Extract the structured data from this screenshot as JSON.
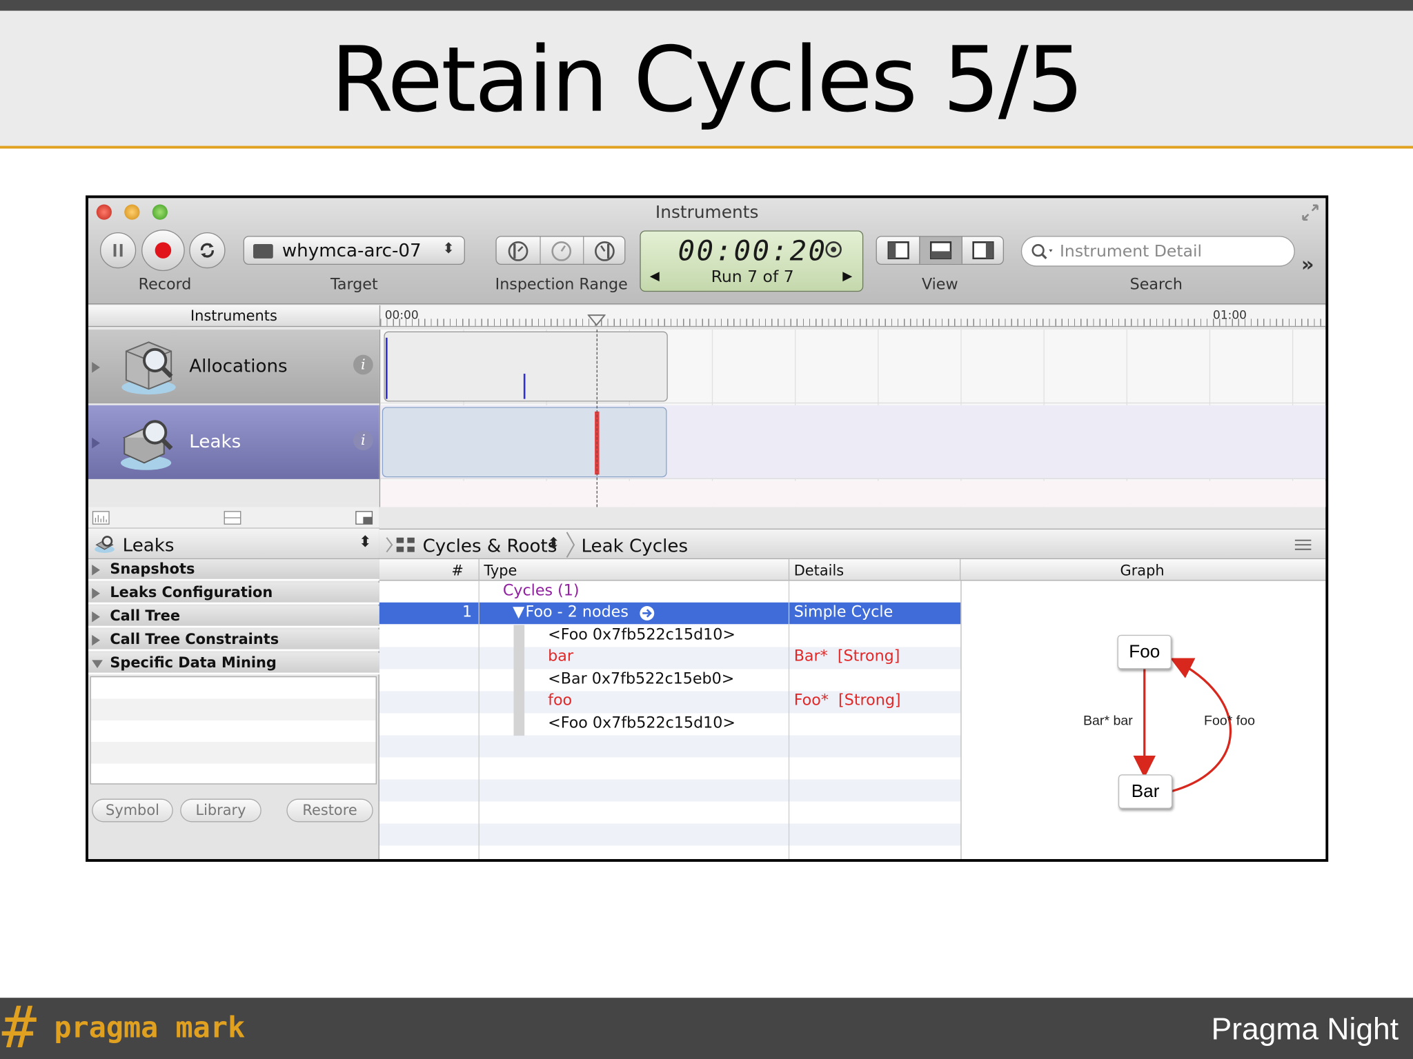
{
  "slide": {
    "title": "Retain Cycles 5/5",
    "footer_brand_symbol": "#",
    "footer_brand_text": "pragma mark",
    "footer_right": "Pragma Night",
    "accent_color": "#e0a020"
  },
  "window": {
    "title": "Instruments",
    "toolbar": {
      "record_label": "Record",
      "target_value": "whymca-arc-07",
      "target_label": "Target",
      "inspection_label": "Inspection Range",
      "timer": "00:00:20",
      "run_text": "Run 7 of 7",
      "view_label": "View",
      "search_placeholder": "Instrument Detail",
      "search_label": "Search"
    },
    "timeline": {
      "header": "Instruments",
      "start_label": "00:00",
      "end_label": "01:00"
    },
    "tracks": [
      {
        "name": "Allocations",
        "icon": "allocations-icon"
      },
      {
        "name": "Leaks",
        "icon": "leaks-icon"
      }
    ],
    "left_panel": {
      "instrument_select": "Leaks",
      "sections": [
        "Snapshots",
        "Leaks Configuration",
        "Call Tree",
        "Call Tree Constraints",
        "Specific Data Mining"
      ],
      "buttons": [
        "Symbol",
        "Library",
        "Restore"
      ]
    },
    "breadcrumb": {
      "view": "Cycles & Roots",
      "detail": "Leak Cycles"
    },
    "columns": [
      "#",
      "Type",
      "Details",
      "Graph"
    ],
    "rows": [
      {
        "num": "",
        "type": "Cycles (1)",
        "details": ""
      },
      {
        "num": "1",
        "type": "Foo - 2 nodes",
        "details": "Simple Cycle"
      },
      {
        "num": "",
        "type": "<Foo 0x7fb522c15d10>",
        "details": ""
      },
      {
        "num": "",
        "type": "bar",
        "details": "Bar*  [Strong]"
      },
      {
        "num": "",
        "type": "<Bar 0x7fb522c15eb0>",
        "details": ""
      },
      {
        "num": "",
        "type": "foo",
        "details": "Foo*  [Strong]"
      },
      {
        "num": "",
        "type": "<Foo 0x7fb522c15d10>",
        "details": ""
      }
    ],
    "graph": {
      "node_top": "Foo",
      "node_bottom": "Bar",
      "edge_left_label": "Bar* bar",
      "edge_right_label": "Foo* foo",
      "edge_color": "#d8281e"
    }
  }
}
